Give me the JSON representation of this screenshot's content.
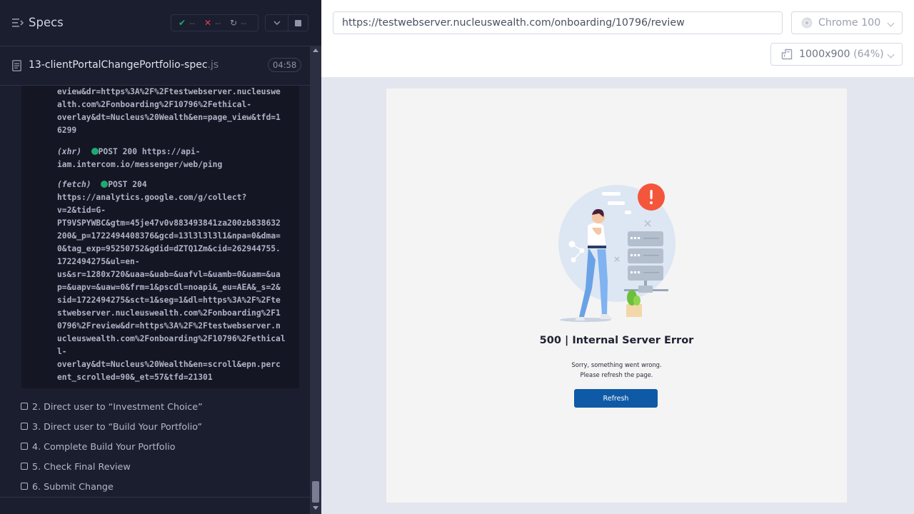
{
  "sidebar": {
    "title": "Specs",
    "stats": {
      "passed": "--",
      "failed": "--",
      "pending": "--"
    },
    "spec_file": {
      "name": "13-clientPortalChangePortfolio-spec",
      "ext": ".js",
      "duration": "04:58"
    },
    "log_lines": [
      "eview&dr=https%3A%2F%2Ftestwebserver.nucleuswe",
      "alth.com%2Fonboarding%2F10796%2Fethical-",
      "overlay&dt=Nucleus%20Wealth&en=page_view&tfd=1",
      "6299",
      "",
      "(xhr)  ● POST 200 https://api-",
      "iam.intercom.io/messenger/web/ping",
      "",
      "(fetch)  ● POST 204",
      "https://analytics.google.com/g/collect?",
      "v=2&tid=G-",
      "PT9VSPYWBC&gtm=45je47v0v883493841za200zb838632",
      "200&_p=1722494408376&gcd=13l3l3l3l1&npa=0&dma=",
      "0&tag_exp=95250752&gdid=dZTQ1Zm&cid=262944755.",
      "1722494275&ul=en-",
      "us&sr=1280x720&uaa=&uab=&uafvl=&uamb=0&uam=&ua",
      "p=&uapv=&uaw=0&frm=1&pscdl=noapi&_eu=AEA&_s=2&",
      "sid=1722494275&sct=1&seg=1&dl=https%3A%2F%2Fte",
      "stwebserver.nucleuswealth.com%2Fonboarding%2F1",
      "0796%2Freview&dr=https%3A%2F%2Ftestwebserver.n",
      "ucleuswealth.com%2Fonboarding%2F10796%2Fethical",
      "l-",
      "overlay&dt=Nucleus%20Wealth&en=scroll&epn.perc",
      "ent_scrolled=90&_et=57&tfd=21301"
    ],
    "xhr": {
      "type": "(xhr)",
      "method_status": "POST 200",
      "url": "https://api-"
    },
    "fetch": {
      "type": "(fetch)",
      "method_status": "POST 204"
    },
    "steps": [
      "2. Direct user to “Investment Choice”",
      "3. Direct user to “Build Your Portfolio”",
      "4. Complete Build Your Portfolio",
      "5. Check Final Review",
      "6. Submit Change"
    ]
  },
  "browser": {
    "url": "https://testwebserver.nucleuswealth.com/onboarding/10796/review",
    "name": "Chrome 100",
    "viewport": "1000x900",
    "scale": "(64%)"
  },
  "app": {
    "error_title": "500 | Internal Server Error",
    "error_line1": "Sorry, something went wrong.",
    "error_line2": "Please refresh the page.",
    "refresh_label": "Refresh"
  },
  "colors": {
    "pass": "#1fa971",
    "fail": "#e2434d",
    "accent": "#0f5aa6",
    "alert": "#f4563c"
  }
}
